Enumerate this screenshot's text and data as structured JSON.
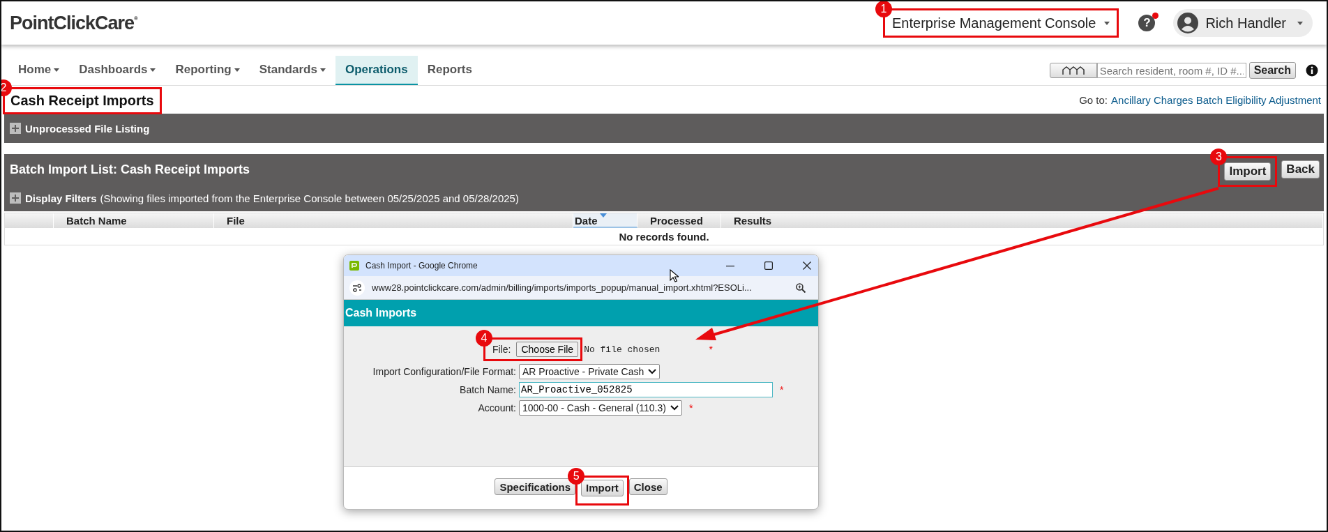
{
  "header": {
    "logo": "PointClickCare$^{®}$",
    "console_menu": {
      "label": "Enterprise Management Console",
      "callout": "1"
    },
    "help": {
      "symbol": "?",
      "notification": true
    },
    "user_menu": {
      "name": "Rich Handler"
    }
  },
  "nav": {
    "tabs": [
      {
        "label": "Home",
        "dropdown": true,
        "selected": false
      },
      {
        "label": "Dashboards",
        "dropdown": true,
        "selected": false
      },
      {
        "label": "Reporting",
        "dropdown": true,
        "selected": false
      },
      {
        "label": "Standards",
        "dropdown": true,
        "selected": false
      },
      {
        "label": "Operations",
        "dropdown": false,
        "selected": true
      },
      {
        "label": "Reports",
        "dropdown": false,
        "selected": false
      }
    ],
    "search": {
      "placeholder": "Search resident, room #, ID #...",
      "button": "Search"
    }
  },
  "page_title": {
    "text": "Cash Receipt Imports",
    "callout": "2"
  },
  "goto": {
    "label": "Go to:",
    "link": "Ancillary Charges Batch Eligibility Adjustment"
  },
  "unprocessed_panel": {
    "title": "Unprocessed File Listing",
    "expanded": false
  },
  "batch_list": {
    "title": "Batch Import List: Cash Receipt Imports",
    "buttons": [
      {
        "label": "Import",
        "callout": "3"
      },
      {
        "label": "Back"
      }
    ],
    "filters": {
      "title": "Display Filters",
      "description": "(Showing files imported from the Enterprise Console between 05/25/2025 and 05/28/2025)",
      "expanded": false
    },
    "table": {
      "columns": [
        {
          "label": "Batch Name",
          "sorted": false
        },
        {
          "label": "File",
          "sorted": false
        },
        {
          "label": "Date",
          "sorted": true
        },
        {
          "label": "Processed",
          "sorted": false
        },
        {
          "label": "Results",
          "sorted": false
        }
      ],
      "empty_message": "No records found."
    }
  },
  "popup": {
    "window_title": "Cash Import - Google Chrome",
    "url": "www28.pointclickcare.com/admin/billing/imports/imports_popup/manual_import.xhtml?ESOLi...",
    "heading": "Cash Imports",
    "fields": [
      {
        "kind": "file",
        "label": "File:",
        "button": "Choose File",
        "value": "No file chosen",
        "required_mark": "*",
        "callout": "4"
      },
      {
        "kind": "select",
        "label": "Import Configuration/File Format:",
        "value": "AR Proactive - Private Cash"
      },
      {
        "kind": "text",
        "label": "Batch Name:",
        "value": "AR_Proactive_052825",
        "required_mark": "*"
      },
      {
        "kind": "select",
        "label": "Account:",
        "value": "1000-00 - Cash - General (110.3)",
        "required_mark": "*"
      }
    ],
    "buttons": [
      {
        "label": "Specifications"
      },
      {
        "label": "Import",
        "callout": "5"
      },
      {
        "label": "Close"
      }
    ]
  }
}
